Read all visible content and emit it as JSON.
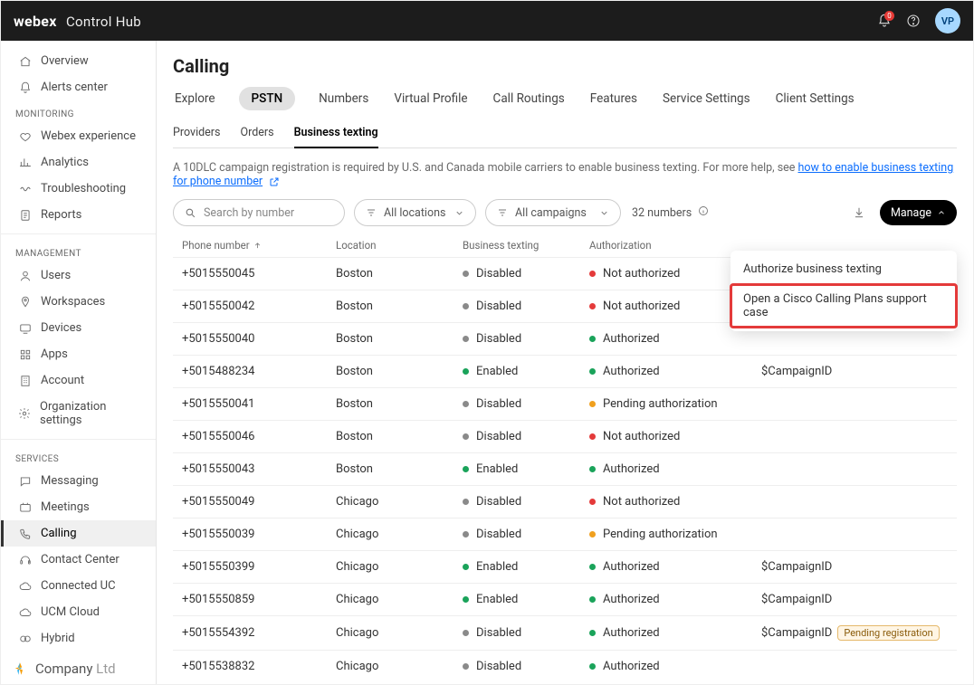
{
  "header": {
    "brand": "webex",
    "brand_sub": "Control Hub",
    "avatar": "VP",
    "notif_badge": "0"
  },
  "sidebar": {
    "primary": [
      {
        "label": "Overview",
        "icon": "home"
      },
      {
        "label": "Alerts center",
        "icon": "bell"
      }
    ],
    "monitoring_title": "MONITORING",
    "monitoring": [
      {
        "label": "Webex experience",
        "icon": "heart"
      },
      {
        "label": "Analytics",
        "icon": "bars"
      },
      {
        "label": "Troubleshooting",
        "icon": "wave"
      },
      {
        "label": "Reports",
        "icon": "doc"
      }
    ],
    "management_title": "MANAGEMENT",
    "management": [
      {
        "label": "Users",
        "icon": "user"
      },
      {
        "label": "Workspaces",
        "icon": "pin"
      },
      {
        "label": "Devices",
        "icon": "device"
      },
      {
        "label": "Apps",
        "icon": "grid"
      },
      {
        "label": "Account",
        "icon": "building"
      },
      {
        "label": "Organization settings",
        "icon": "gear"
      }
    ],
    "services_title": "SERVICES",
    "services": [
      {
        "label": "Messaging",
        "icon": "msg",
        "active": false
      },
      {
        "label": "Meetings",
        "icon": "meeting",
        "active": false
      },
      {
        "label": "Calling",
        "icon": "phone",
        "active": true
      },
      {
        "label": "Contact Center",
        "icon": "headset",
        "active": false
      },
      {
        "label": "Connected UC",
        "icon": "cloud",
        "active": false
      },
      {
        "label": "UCM Cloud",
        "icon": "cloud",
        "active": false
      },
      {
        "label": "Hybrid",
        "icon": "hybrid",
        "active": false
      }
    ],
    "company": "Company",
    "company_suffix": "Ltd"
  },
  "page": {
    "title": "Calling",
    "tabs_primary": [
      "Explore",
      "PSTN",
      "Numbers",
      "Virtual Profile",
      "Call Routings",
      "Features",
      "Service Settings",
      "Client Settings"
    ],
    "tabs_primary_active": "PSTN",
    "tabs_secondary": [
      "Providers",
      "Orders",
      "Business texting"
    ],
    "tabs_secondary_active": "Business texting",
    "info_text": "A 10DLC campaign registration is required by U.S. and Canada mobile carriers to enable business texting. For more help, see ",
    "info_link": "how to enable business texting for phone number",
    "toolbar": {
      "search_placeholder": "Search by number",
      "locations": "All locations",
      "campaigns": "All campaigns",
      "count": "32 numbers",
      "manage": "Manage"
    },
    "columns": [
      "Phone number",
      "Location",
      "Business texting",
      "Authorization",
      ""
    ],
    "rows": [
      {
        "phone": "+5015550045",
        "loc": "Boston",
        "bt": "Disabled",
        "btc": "grey",
        "auth": "Not authorized",
        "authc": "red",
        "camp": ""
      },
      {
        "phone": "+5015550042",
        "loc": "Boston",
        "bt": "Disabled",
        "btc": "grey",
        "auth": "Not authorized",
        "authc": "red",
        "camp": ""
      },
      {
        "phone": "+5015550040",
        "loc": "Boston",
        "bt": "Disabled",
        "btc": "grey",
        "auth": "Authorized",
        "authc": "green",
        "camp": ""
      },
      {
        "phone": "+5015488234",
        "loc": "Boston",
        "bt": "Enabled",
        "btc": "green",
        "auth": "Authorized",
        "authc": "green",
        "camp": "$CampaignID"
      },
      {
        "phone": "+5015550041",
        "loc": "Boston",
        "bt": "Disabled",
        "btc": "grey",
        "auth": "Pending authorization",
        "authc": "orange",
        "camp": ""
      },
      {
        "phone": "+5015550046",
        "loc": "Boston",
        "bt": "Disabled",
        "btc": "grey",
        "auth": "Not authorized",
        "authc": "red",
        "camp": ""
      },
      {
        "phone": "+5015550043",
        "loc": "Boston",
        "bt": "Enabled",
        "btc": "green",
        "auth": "Authorized",
        "authc": "green",
        "camp": ""
      },
      {
        "phone": "+5015550049",
        "loc": "Chicago",
        "bt": "Disabled",
        "btc": "grey",
        "auth": "Not authorized",
        "authc": "red",
        "camp": ""
      },
      {
        "phone": "+5015550039",
        "loc": "Chicago",
        "bt": "Disabled",
        "btc": "grey",
        "auth": "Pending authorization",
        "authc": "orange",
        "camp": ""
      },
      {
        "phone": "+5015550399",
        "loc": "Chicago",
        "bt": "Enabled",
        "btc": "green",
        "auth": "Authorized",
        "authc": "green",
        "camp": "$CampaignID"
      },
      {
        "phone": "+5015550859",
        "loc": "Chicago",
        "bt": "Enabled",
        "btc": "green",
        "auth": "Authorized",
        "authc": "green",
        "camp": "$CampaignID"
      },
      {
        "phone": "+5015554392",
        "loc": "Chicago",
        "bt": "Disabled",
        "btc": "grey",
        "auth": "Authorized",
        "authc": "green",
        "camp": "$CampaignID",
        "reg": "Pending registration"
      },
      {
        "phone": "+5015538832",
        "loc": "Chicago",
        "bt": "Disabled",
        "btc": "grey",
        "auth": "Authorized",
        "authc": "green",
        "camp": ""
      }
    ],
    "dropdown": [
      "Authorize business texting",
      "Open a Cisco Calling Plans support case"
    ]
  }
}
